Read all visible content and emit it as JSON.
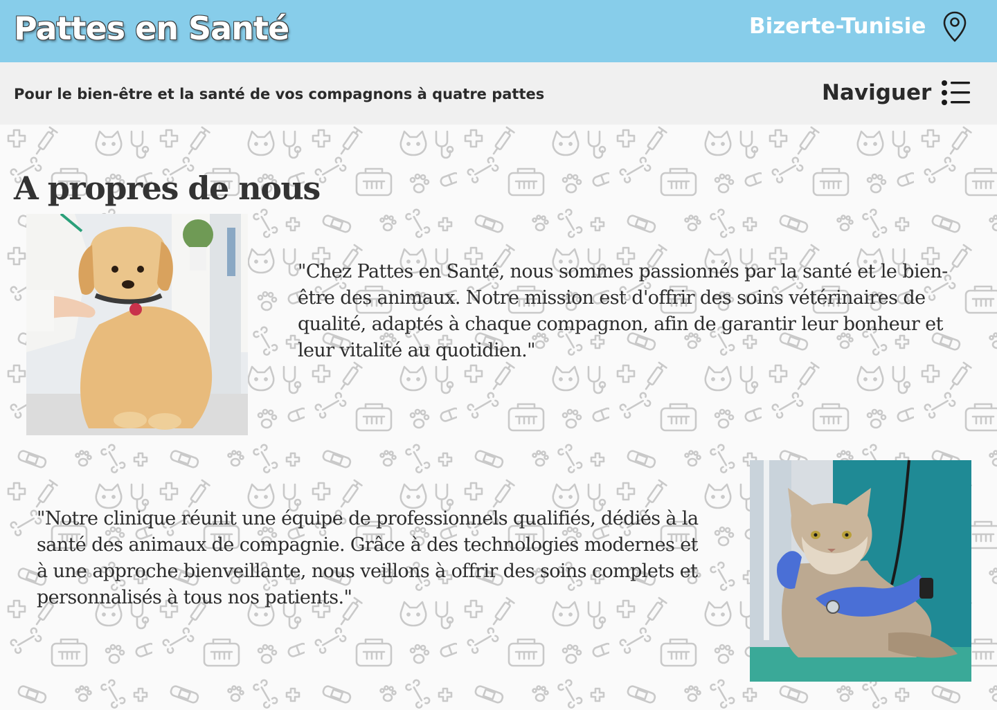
{
  "header": {
    "brand": "Pattes en Santé",
    "location": "Bizerte-Tunisie",
    "location_icon": "map-pin-icon"
  },
  "subheader": {
    "tagline": "Pour le bien-être et la santé de vos compagnons à quatre pattes",
    "nav_label": "Naviguer",
    "nav_icon": "list-menu-icon"
  },
  "colors": {
    "header_bg": "#87cdea",
    "subheader_bg": "#f0f0f0",
    "pattern_stroke": "#c8c8c8"
  },
  "about": {
    "title": "A propres de nous",
    "quote_1": "\"Chez Pattes en Santé, nous sommes passionnés par la santé et le bien-être des animaux. Notre mission est d'offrir des soins vétérinaires de qualité, adaptés à chaque compagnon, afin de garantir leur bonheur et leur vitalité au quotidien.\"",
    "quote_2": "\"Notre clinique réunit une équipe de professionnels qualifiés, dédiés à la santé des animaux de compagnie. Grâce à des technologies modernes et à une approche bienveillante, nous veillons à offrir des soins complets et personnalisés à tous nos patients.\""
  }
}
